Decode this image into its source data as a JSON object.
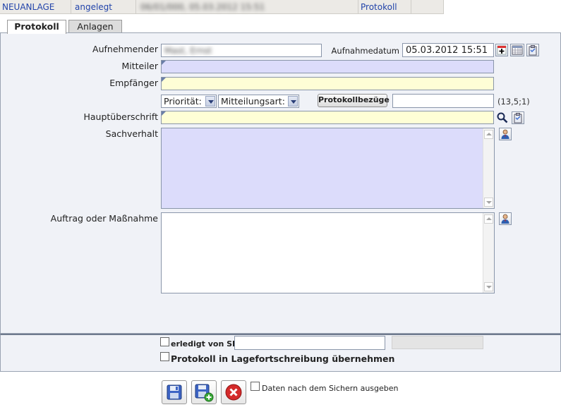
{
  "status_bar": {
    "mode": "NEUANLAGE",
    "state": "angelegt",
    "info_redacted": "06/01/000, 05.03.2012 15:51",
    "link": "Protokoll"
  },
  "tabs": [
    {
      "label": "Protokoll",
      "active": true
    },
    {
      "label": "Anlagen",
      "active": false
    }
  ],
  "form": {
    "aufnehmender_label": "Aufnehmender",
    "aufnehmender_value": "Mast, Ernst",
    "aufnahmedatum_label": "Aufnahmedatum",
    "aufnahmedatum_value": "05.03.2012 15:51",
    "mitteiler_label": "Mitteiler",
    "mitteiler_value": "",
    "empfaenger_label": "Empfänger",
    "empfaenger_value": "",
    "prioritaet_value": "Priorität:",
    "mitteilungsart_value": "Mitteilungsart:",
    "protokollbezuege_label": "Protokollbezüge",
    "protokollbezuege_value": "",
    "coords": "(13,5;1)",
    "hauptueberschrift_label": "Hauptüberschrift",
    "hauptueberschrift_value": "",
    "sachverhalt_label": "Sachverhalt",
    "auftrag_label": "Auftrag oder Maßnahme"
  },
  "footer": {
    "erledigt_label": "erledigt von SB",
    "erledigt_value": "",
    "lage_label": "Protokoll in Lagefortschreibung übernehmen"
  },
  "actions": {
    "print_label": "Daten nach dem Sichern ausgeben"
  },
  "colors": {
    "accent_blue": "#2244aa",
    "field_lavender": "#dcdcfb",
    "field_yellow": "#fefed6",
    "cancel_red": "#d42a2a"
  },
  "icons": [
    "plus-icon",
    "calendar-icon",
    "clipboard-icon",
    "search-icon",
    "person-icon",
    "save-icon",
    "save-new-icon",
    "cancel-icon"
  ]
}
